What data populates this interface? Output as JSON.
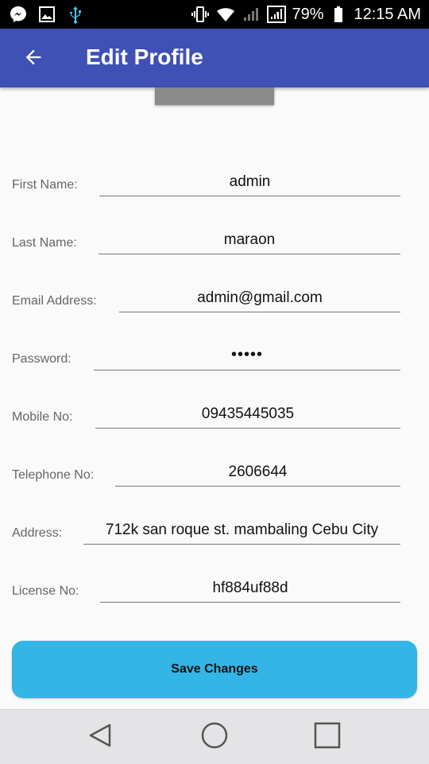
{
  "status_bar": {
    "battery": "79%",
    "time": "12:15 AM",
    "icons": [
      "messenger-icon",
      "gallery-icon",
      "usb-icon",
      "vibrate-icon",
      "wifi-icon",
      "signal-icon",
      "signal-h-icon",
      "battery-icon"
    ]
  },
  "app_bar": {
    "title": "Edit Profile",
    "back_icon": "arrow-left-icon",
    "color": "#3f51b5"
  },
  "form": {
    "first_name": {
      "label": "First Name:",
      "value": "admin"
    },
    "last_name": {
      "label": "Last Name:",
      "value": "maraon"
    },
    "email": {
      "label": "Email Address:",
      "value": "admin@gmail.com"
    },
    "password": {
      "label": "Password:",
      "value": "•••••"
    },
    "mobile": {
      "label": "Mobile No:",
      "value": "09435445035"
    },
    "telephone": {
      "label": "Telephone No:",
      "value": "2606644"
    },
    "address": {
      "label": "Address:",
      "value": "712k san roque st. mambaling Cebu City"
    },
    "license": {
      "label": "License No:",
      "value": "hf884uf88d"
    }
  },
  "save_button": {
    "label": "Save Changes",
    "color": "#33b5e5"
  },
  "nav_bar": {
    "icons": [
      "back-triangle-icon",
      "home-circle-icon",
      "recents-square-icon"
    ]
  }
}
